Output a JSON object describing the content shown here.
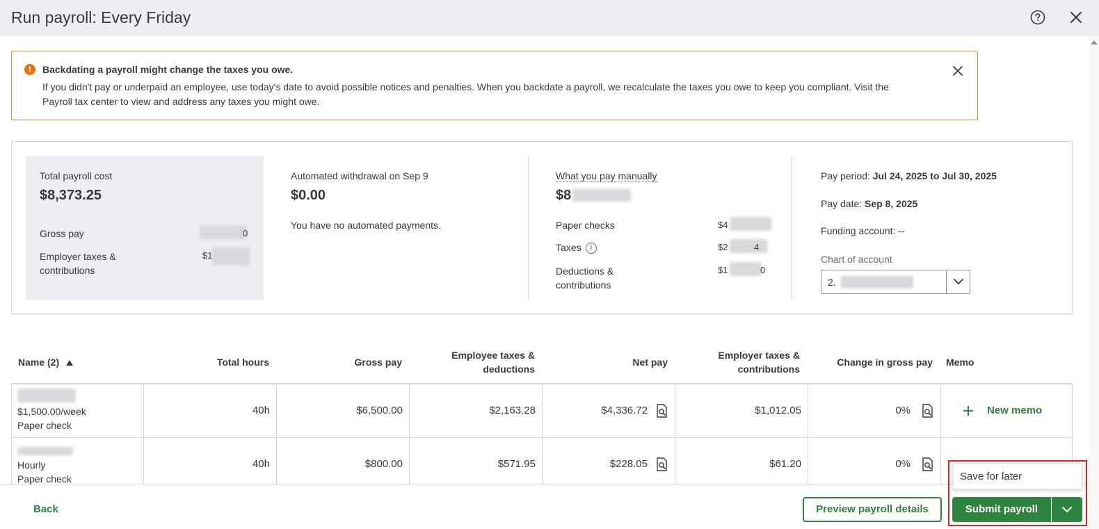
{
  "header": {
    "title": "Run payroll: Every Friday"
  },
  "alert": {
    "title": "Backdating a payroll might change the taxes you owe.",
    "body": "If you didn't pay or underpaid an employee, use today's date to avoid possible notices and penalties. When you backdate a payroll, we recalculate the taxes you owe to keep you compliant. Visit the Payroll tax center to view and address any taxes you might owe."
  },
  "summary": {
    "total_cost_label": "Total payroll cost",
    "total_cost_value": "$8,373.25",
    "gross_pay_label": "Gross pay",
    "gross_pay_value_visible": "0",
    "employer_taxes_label": "Employer taxes & contributions",
    "employer_taxes_value_visible": "$1",
    "auto_withdrawal_label": "Automated withdrawal on Sep 9",
    "auto_withdrawal_value": "$0.00",
    "auto_withdrawal_note": "You have no automated payments.",
    "manual_label": "What you pay manually",
    "manual_value_visible": "$8",
    "paper_checks_label": "Paper checks",
    "paper_checks_value_visible": "$4",
    "taxes_label": "Taxes",
    "taxes_value_visible": "$2",
    "taxes_value_tail": "4",
    "deductions_label": "Deductions & contributions",
    "deductions_value_visible": "$1",
    "deductions_value_tail": "0",
    "pay_period_label": "Pay period:",
    "pay_period_value": "Jul 24, 2025 to Jul 30, 2025",
    "pay_date_label": "Pay date:",
    "pay_date_value": "Sep 8, 2025",
    "funding_account": "Funding account: --",
    "chart_of_account_label": "Chart of account",
    "chart_of_account_value_visible": "2."
  },
  "table": {
    "headers": {
      "name": "Name (2)",
      "total_hours": "Total hours",
      "gross_pay": "Gross pay",
      "employee_taxes_line1": "Employee taxes &",
      "employee_taxes_line2": "deductions",
      "net_pay": "Net pay",
      "employer_taxes_line1": "Employer taxes &",
      "employer_taxes_line2": "contributions",
      "change_in_gross": "Change in gross pay",
      "memo": "Memo"
    },
    "rows": [
      {
        "rate": "$1,500.00/week",
        "pay_method": "Paper check",
        "hours": "40h",
        "gross_pay": "$6,500.00",
        "employee_taxes": "$2,163.28",
        "net_pay": "$4,336.72",
        "employer_taxes": "$1,012.05",
        "change": "0%",
        "memo": "New memo"
      },
      {
        "rate": "Hourly",
        "pay_method": "Paper check",
        "hours": "40h",
        "gross_pay": "$800.00",
        "employee_taxes": "$571.95",
        "net_pay": "$228.05",
        "employer_taxes": "$61.20",
        "change": "0%"
      }
    ]
  },
  "footer": {
    "back": "Back",
    "preview": "Preview payroll details",
    "submit": "Submit payroll",
    "save_for_later": "Save for later"
  },
  "colors": {
    "primary_green": "#2e8540",
    "alert_orange": "#e8710f",
    "highlight_red": "#e02020"
  }
}
